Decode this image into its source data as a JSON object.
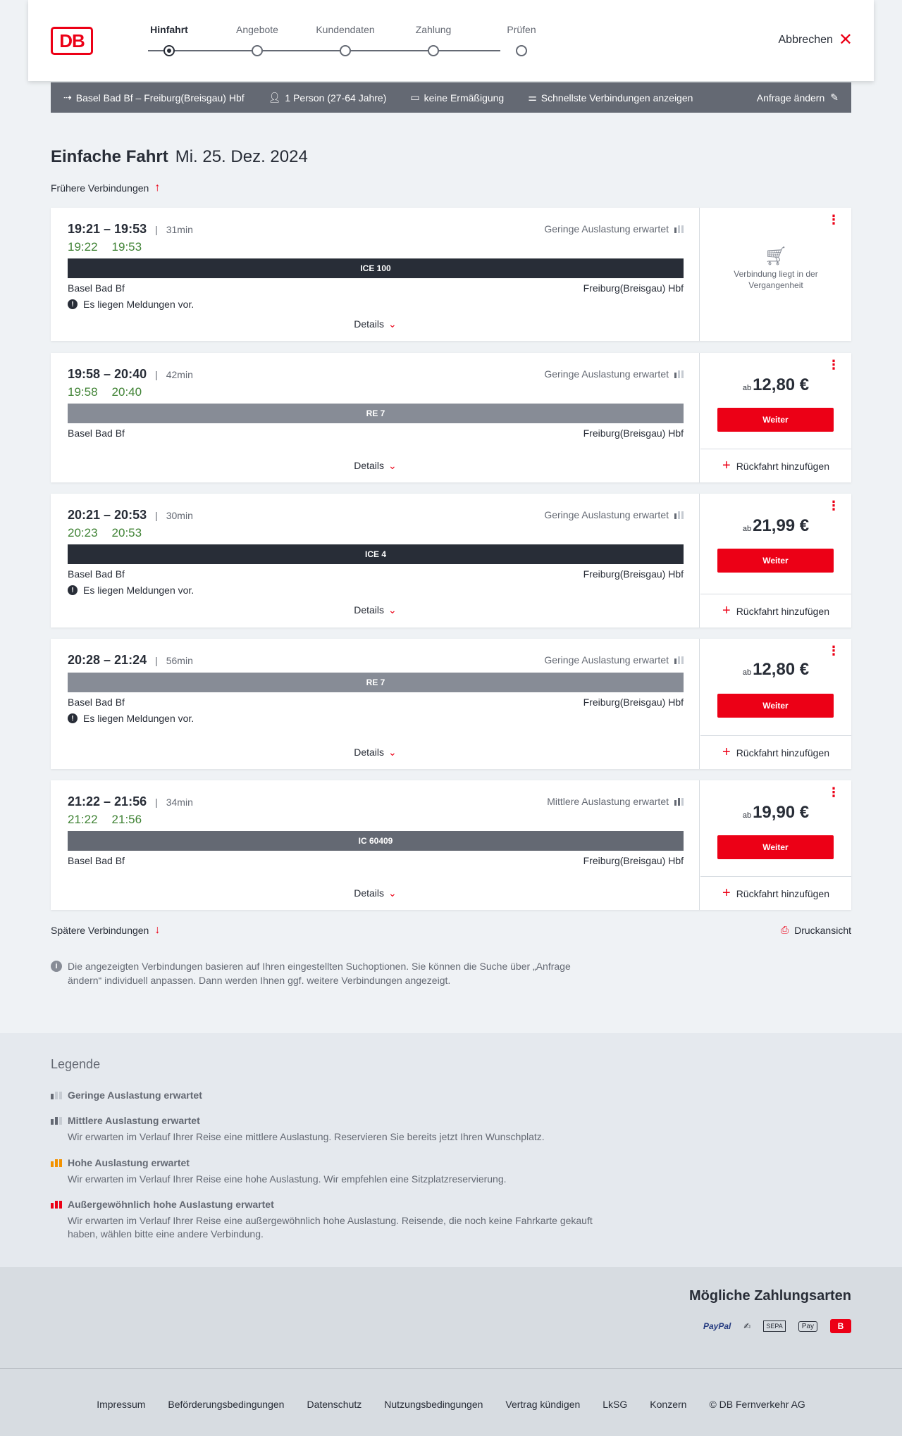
{
  "header": {
    "logo": "DB",
    "steps": [
      {
        "label": "Hinfahrt",
        "active": true
      },
      {
        "label": "Angebote",
        "active": false
      },
      {
        "label": "Kundendaten",
        "active": false
      },
      {
        "label": "Zahlung",
        "active": false
      },
      {
        "label": "Prüfen",
        "active": false
      }
    ],
    "cancel_label": "Abbrechen"
  },
  "query": {
    "route": "Basel Bad Bf – Freiburg(Breisgau) Hbf",
    "persons": "1 Person (27-64 Jahre)",
    "discount": "keine Ermäßigung",
    "option": "Schnellste Verbindungen anzeigen",
    "change_label": "Anfrage ändern"
  },
  "main": {
    "title_bold": "Einfache Fahrt",
    "title_date": "Mi. 25. Dez. 2024",
    "earlier_label": "Frühere Verbindungen",
    "later_label": "Spätere Verbindungen",
    "print_label": "Druckansicht",
    "info_text": "Die angezeigten Verbindungen basieren auf Ihren eingestellten Suchoptionen. Sie können die Suche über „Anfrage ändern“ individuell anpassen. Dann werden Ihnen ggf. weitere Verbindungen angezeigt."
  },
  "connections": [
    {
      "times": "19:21 – 19:53",
      "duration": "31min",
      "rt_dep": "19:22",
      "rt_arr": "19:53",
      "load": "Geringe Auslastung erwartet",
      "train": "ICE 100",
      "from": "Basel Bad Bf",
      "to": "Freiburg(Breisgau) Hbf",
      "notice": "Es liegen Meldungen vor.",
      "details": "Details",
      "past_text": "Verbindung liegt in der Vergangenheit"
    },
    {
      "times": "19:58 – 20:40",
      "duration": "42min",
      "rt_dep": "19:58",
      "rt_arr": "20:40",
      "load": "Geringe Auslastung erwartet",
      "train": "RE 7",
      "from": "Basel Bad Bf",
      "to": "Freiburg(Breisgau) Hbf",
      "details": "Details",
      "price_prefix": "ab",
      "price": "12,80 €",
      "button": "Weiter",
      "return_label": "Rückfahrt hinzufügen"
    },
    {
      "times": "20:21 – 20:53",
      "duration": "30min",
      "rt_dep": "20:23",
      "rt_arr": "20:53",
      "load": "Geringe Auslastung erwartet",
      "train": "ICE 4",
      "from": "Basel Bad Bf",
      "to": "Freiburg(Breisgau) Hbf",
      "notice": "Es liegen Meldungen vor.",
      "details": "Details",
      "price_prefix": "ab",
      "price": "21,99 €",
      "button": "Weiter",
      "return_label": "Rückfahrt hinzufügen"
    },
    {
      "times": "20:28 – 21:24",
      "duration": "56min",
      "load": "Geringe Auslastung erwartet",
      "train": "RE 7",
      "from": "Basel Bad Bf",
      "to": "Freiburg(Breisgau) Hbf",
      "notice": "Es liegen Meldungen vor.",
      "details": "Details",
      "price_prefix": "ab",
      "price": "12,80 €",
      "button": "Weiter",
      "return_label": "Rückfahrt hinzufügen"
    },
    {
      "times": "21:22 – 21:56",
      "duration": "34min",
      "rt_dep": "21:22",
      "rt_arr": "21:56",
      "load": "Mittlere Auslastung erwartet",
      "train": "IC 60409",
      "from": "Basel Bad Bf",
      "to": "Freiburg(Breisgau) Hbf",
      "details": "Details",
      "price_prefix": "ab",
      "price": "19,90 €",
      "button": "Weiter",
      "return_label": "Rückfahrt hinzufügen"
    }
  ],
  "legend": {
    "title": "Legende",
    "items": [
      {
        "label": "Geringe Auslastung erwartet",
        "desc": ""
      },
      {
        "label": "Mittlere Auslastung erwartet",
        "desc": "Wir erwarten im Verlauf Ihrer Reise eine mittlere Auslastung. Reservieren Sie bereits jetzt Ihren Wunschplatz."
      },
      {
        "label": "Hohe Auslastung erwartet",
        "desc": "Wir erwarten im Verlauf Ihrer Reise eine hohe Auslastung. Wir empfehlen eine Sitzplatzreservierung."
      },
      {
        "label": "Außergewöhnlich hohe Auslastung erwartet",
        "desc": "Wir erwarten im Verlauf Ihrer Reise eine außergewöhnlich hohe Auslastung. Reisende, die noch keine Fahrkarte gekauft haben, wählen bitte eine andere Verbindung."
      }
    ],
    "colors": {
      "low": "#646973",
      "mid": "#646973",
      "high": "#f39200",
      "very_high": "#ec0016"
    }
  },
  "payment": {
    "title": "Mögliche Zahlungsarten",
    "methods": [
      "PayPal",
      "Kreditkarte",
      "SEPA",
      "Apple Pay",
      "DB"
    ],
    "labels": {
      "paypal": "PayPal",
      "sepa": "SEPA",
      "applepay": "Pay",
      "db": "B"
    }
  },
  "footer": {
    "links": [
      "Impressum",
      "Beförderungsbedingungen",
      "Datenschutz",
      "Nutzungsbedingungen",
      "Vertrag kündigen",
      "LkSG",
      "Konzern",
      "© DB Fernverkehr AG"
    ]
  },
  "colors": {
    "brand_red": "#ec0016",
    "realtime_green": "#408335",
    "dark": "#282d37"
  }
}
